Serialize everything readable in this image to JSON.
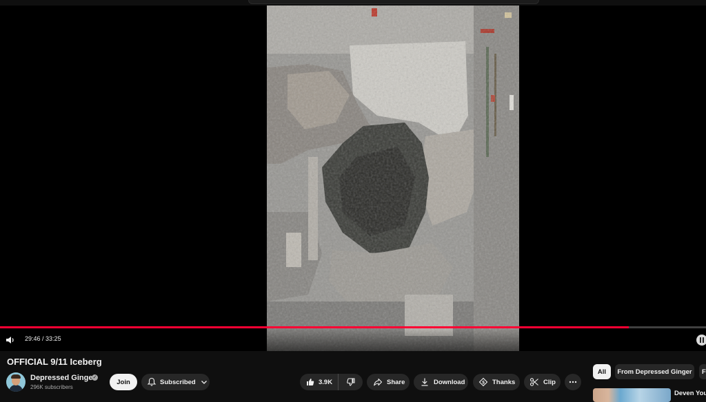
{
  "video": {
    "title": "OFFICIAL 9/11 Iceberg",
    "time_current": "29:46",
    "time_separator": " / ",
    "time_total": "33:25",
    "progress_fraction": 0.8908
  },
  "channel": {
    "name": "Depressed Ginger",
    "subscribers": "296K subscribers",
    "verified": true
  },
  "actions": {
    "join": "Join",
    "subscribed": "Subscribed",
    "likes": "3.9K",
    "share": "Share",
    "download": "Download",
    "thanks": "Thanks",
    "clip": "Clip"
  },
  "chips": {
    "all": "All",
    "from_channel": "From Depressed Ginger",
    "more": "F"
  },
  "related": {
    "first_title": "Deven Your"
  },
  "colors": {
    "accent_red": "#ff0033",
    "background": "#0f0f0f",
    "pill": "#272727",
    "text": "#f1f1f1",
    "subtle_text": "#aaaaaa"
  },
  "icons": {
    "volume": "volume-icon",
    "bell": "bell-icon",
    "chevron": "chevron-down-icon",
    "like": "thumbs-up-icon",
    "dislike": "thumbs-down-icon",
    "share": "share-arrow-icon",
    "download": "download-icon",
    "thanks": "super-thanks-icon",
    "clip": "scissors-icon",
    "more": "more-horizontal-icon",
    "verified": "verified-check-icon",
    "miniplayer": "pause-icon"
  }
}
